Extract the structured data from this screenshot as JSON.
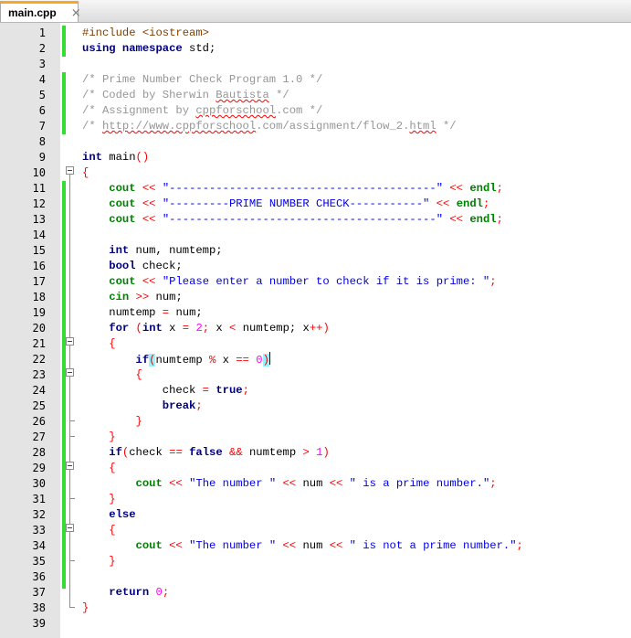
{
  "tab": {
    "label": "main.cpp",
    "close_glyph": "×",
    "icon": "close-icon"
  },
  "lines": [
    {
      "n": "1"
    },
    {
      "n": "2"
    },
    {
      "n": "3"
    },
    {
      "n": "4"
    },
    {
      "n": "5"
    },
    {
      "n": "6"
    },
    {
      "n": "7"
    },
    {
      "n": "8"
    },
    {
      "n": "9"
    },
    {
      "n": "10"
    },
    {
      "n": "11"
    },
    {
      "n": "12"
    },
    {
      "n": "13"
    },
    {
      "n": "14"
    },
    {
      "n": "15"
    },
    {
      "n": "16"
    },
    {
      "n": "17"
    },
    {
      "n": "18"
    },
    {
      "n": "19"
    },
    {
      "n": "20"
    },
    {
      "n": "21"
    },
    {
      "n": "22"
    },
    {
      "n": "23"
    },
    {
      "n": "24"
    },
    {
      "n": "25"
    },
    {
      "n": "26"
    },
    {
      "n": "27"
    },
    {
      "n": "28"
    },
    {
      "n": "29"
    },
    {
      "n": "30"
    },
    {
      "n": "31"
    },
    {
      "n": "32"
    },
    {
      "n": "33"
    },
    {
      "n": "34"
    },
    {
      "n": "35"
    },
    {
      "n": "36"
    },
    {
      "n": "37"
    },
    {
      "n": "38"
    },
    {
      "n": "39"
    }
  ],
  "code": {
    "l1": "#include <iostream>",
    "l2_kw": "using namespace",
    "l2_rest": " std;",
    "l4": "/* Prime Number Check Program 1.0 */",
    "l5_a": "/* Coded by Sherwin ",
    "l5_b": "Bautista",
    "l5_c": " */",
    "l6_a": "/* Assignment by ",
    "l6_b": "cppforschool",
    "l6_c": ".com */",
    "l7_a": "/* ",
    "l7_b": "http://www.cppforschool",
    "l7_c": ".com/assignment/flow_2.",
    "l7_d": "html",
    "l7_e": " */",
    "l9_kw": "int",
    "l9_rest": " main",
    "l9_paren": "()",
    "brace_open": "{",
    "brace_close": "}",
    "cout": "cout",
    "shl": "<<",
    "shr": ">>",
    "endl": "endl",
    "semi": ";",
    "l11_str": "\"----------------------------------------\"",
    "l12_str": "\"---------PRIME NUMBER CHECK-----------\"",
    "l13_str": "\"----------------------------------------\"",
    "l15_kw": "int",
    "l15_rest": " num, numtemp;",
    "l16_kw": "bool",
    "l16_rest": " check;",
    "l17_str": "\"Please enter a number to check if it is prime: \"",
    "l18_cin": "cin",
    "l18_rest": " num;",
    "l19_a": "numtemp",
    "l19_eq": "=",
    "l19_b": " num;",
    "l20_for": "for",
    "l20_int": "int",
    "l20_x": " x ",
    "l20_eq": "=",
    "l20_two": "2",
    "l20_lt": "<",
    "l20_numtemp": " numtemp; x",
    "l20_pp": "++",
    "l22_if": "if",
    "l22_open": "(",
    "l22_numtemp": "numtemp ",
    "l22_mod": "%",
    "l22_x": " x ",
    "l22_eqeq": "==",
    "l22_zero": "0",
    "l22_close": ")",
    "l24_a": "check ",
    "l24_eq": "=",
    "l24_true": "true",
    "l25_break": "break",
    "l28_if": "if",
    "l28_check": "check ",
    "l28_eqeq": "==",
    "l28_false": "false",
    "l28_and": "&&",
    "l28_numtemp": " numtemp ",
    "l28_gt": ">",
    "l28_one": "1",
    "l30_str1": "\"The number \"",
    "l30_num": " num ",
    "l30_str2": "\" is a prime number.\"",
    "l32_else": "else",
    "l34_str1": "\"The number \"",
    "l34_num": " num ",
    "l34_str2": "\" is not a prime number.\"",
    "l37_return": "return",
    "l37_zero": "0"
  },
  "colors": {
    "change_bar": "#33dd33",
    "tab_accent": "#f9a825",
    "keyword": "#000080",
    "string": "#0000e6",
    "comment": "#969696",
    "number": "#ff00ff",
    "operator": "#ff0000",
    "endl": "#008000",
    "brace_match": "#94f4ff"
  }
}
